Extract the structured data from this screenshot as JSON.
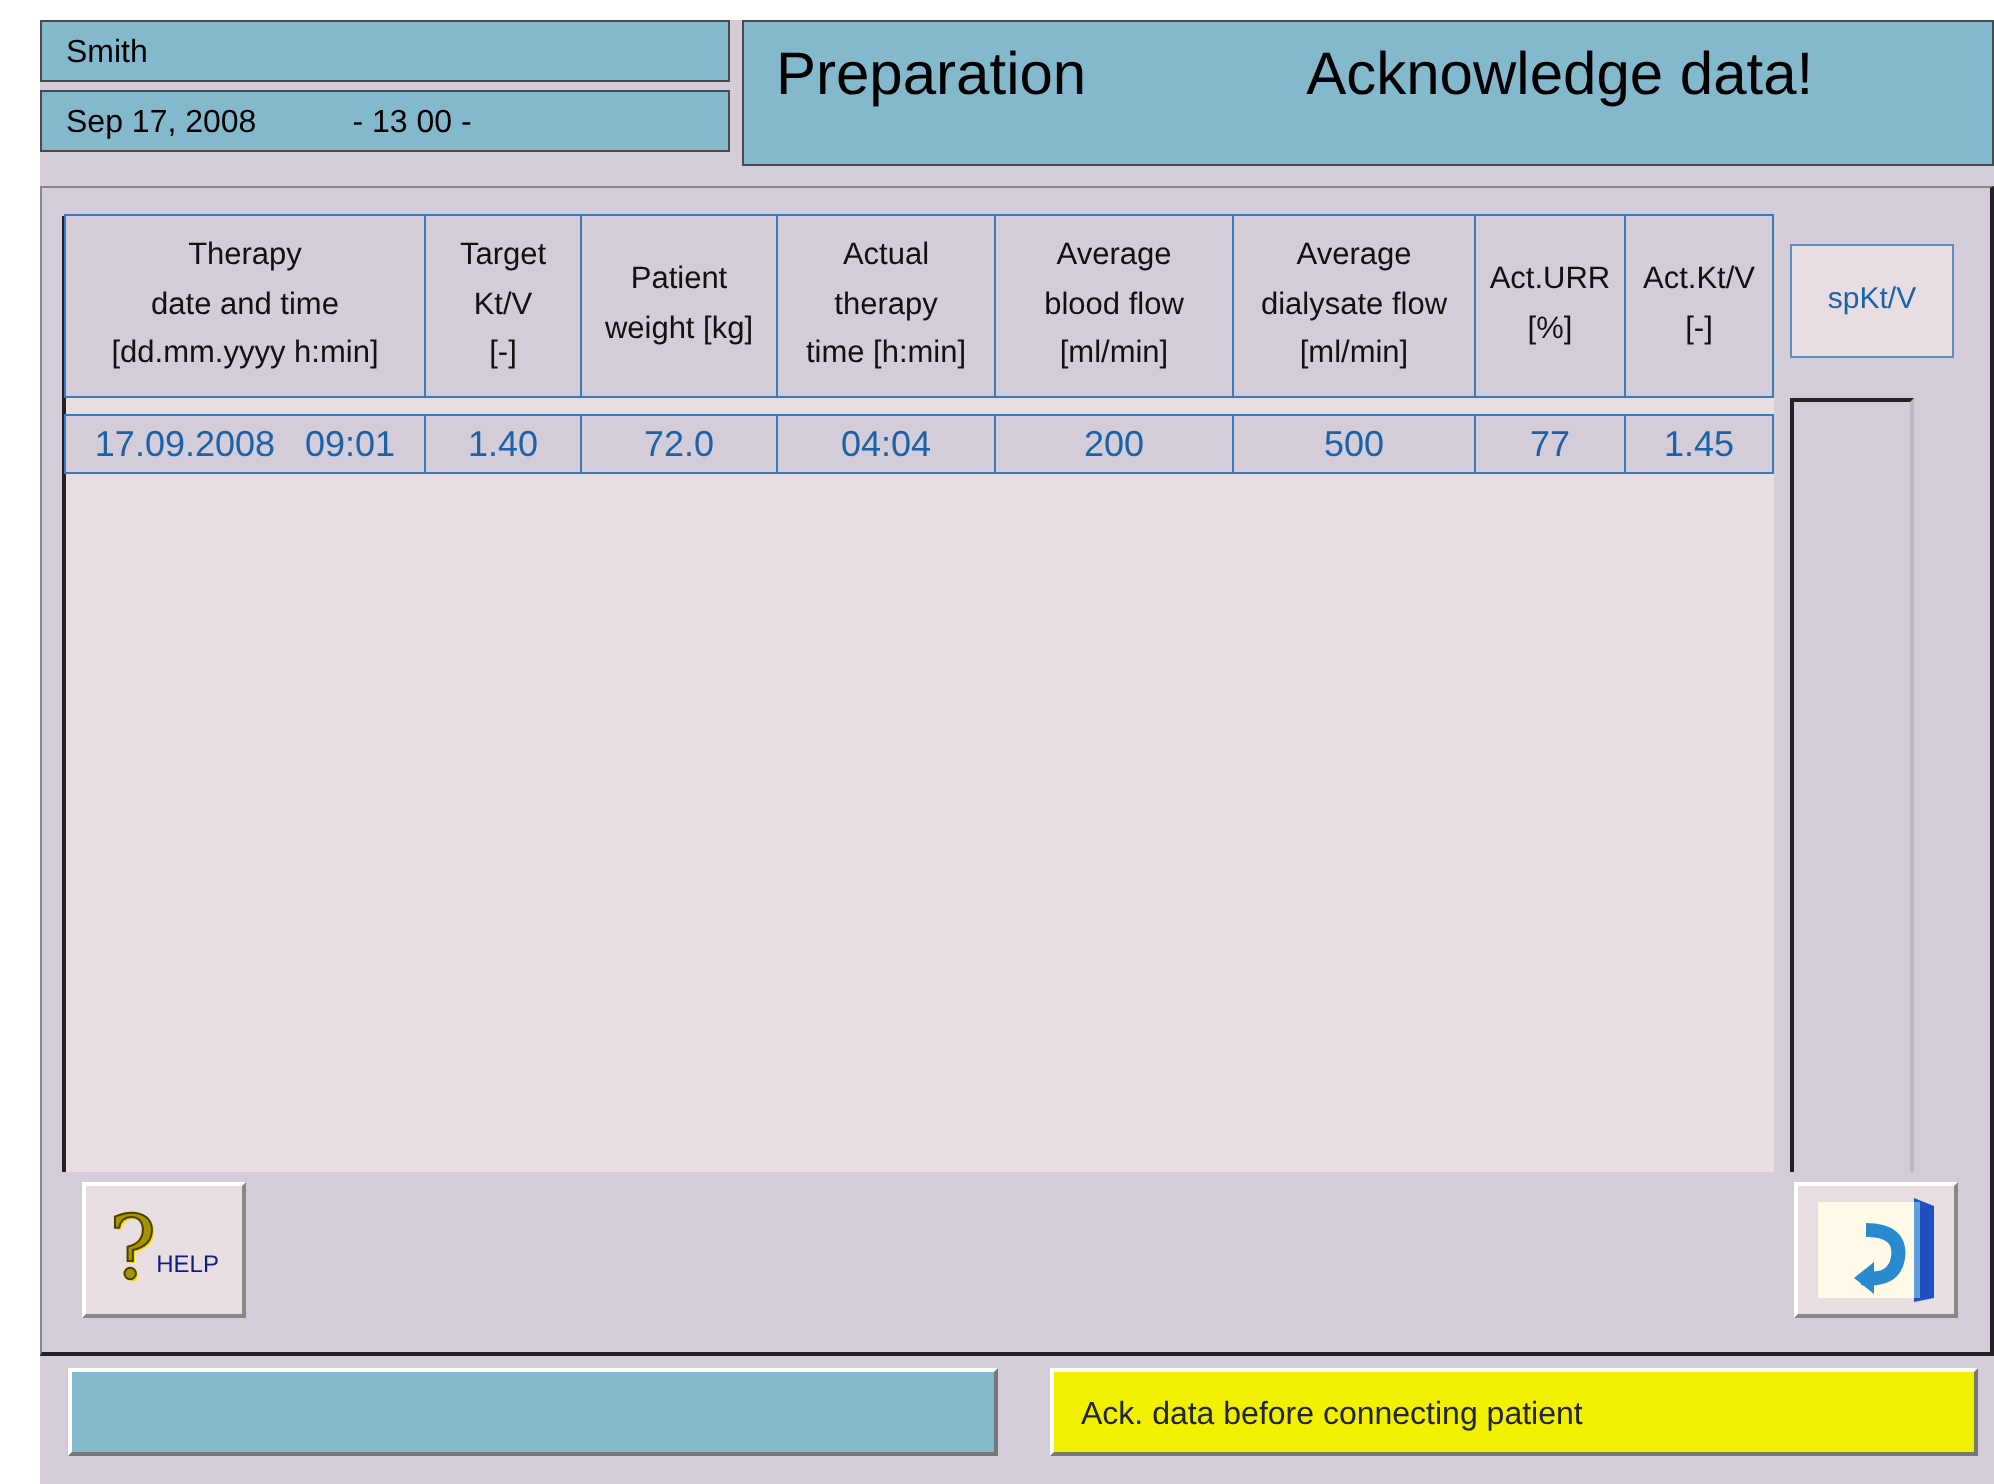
{
  "header": {
    "patient_name": "Smith",
    "date": "Sep 17, 2008",
    "time": "- 13 00 -",
    "title": "Preparation",
    "message": "Acknowledge data!"
  },
  "table": {
    "columns": [
      "Therapy\ndate and time\n[dd.mm.yyyy h:min]",
      "Target\nKt/V\n[-]",
      "Patient\nweight [kg]",
      "Actual\ntherapy\ntime [h:min]",
      "Average\nblood flow\n[ml/min]",
      "Average\ndialysate flow\n[ml/min]",
      "Act.URR\n[%]",
      "Act.Kt/V\n[-]"
    ],
    "rows": [
      [
        "17.09.2008   09:01",
        "1.40",
        "72.0",
        "04:04",
        "200",
        "500",
        "77",
        "1.45"
      ]
    ]
  },
  "side_button": "spKt/V",
  "help_button": {
    "glyph": "?",
    "label": "HELP"
  },
  "status_bar": {
    "right": "Ack. data before connecting patient"
  }
}
